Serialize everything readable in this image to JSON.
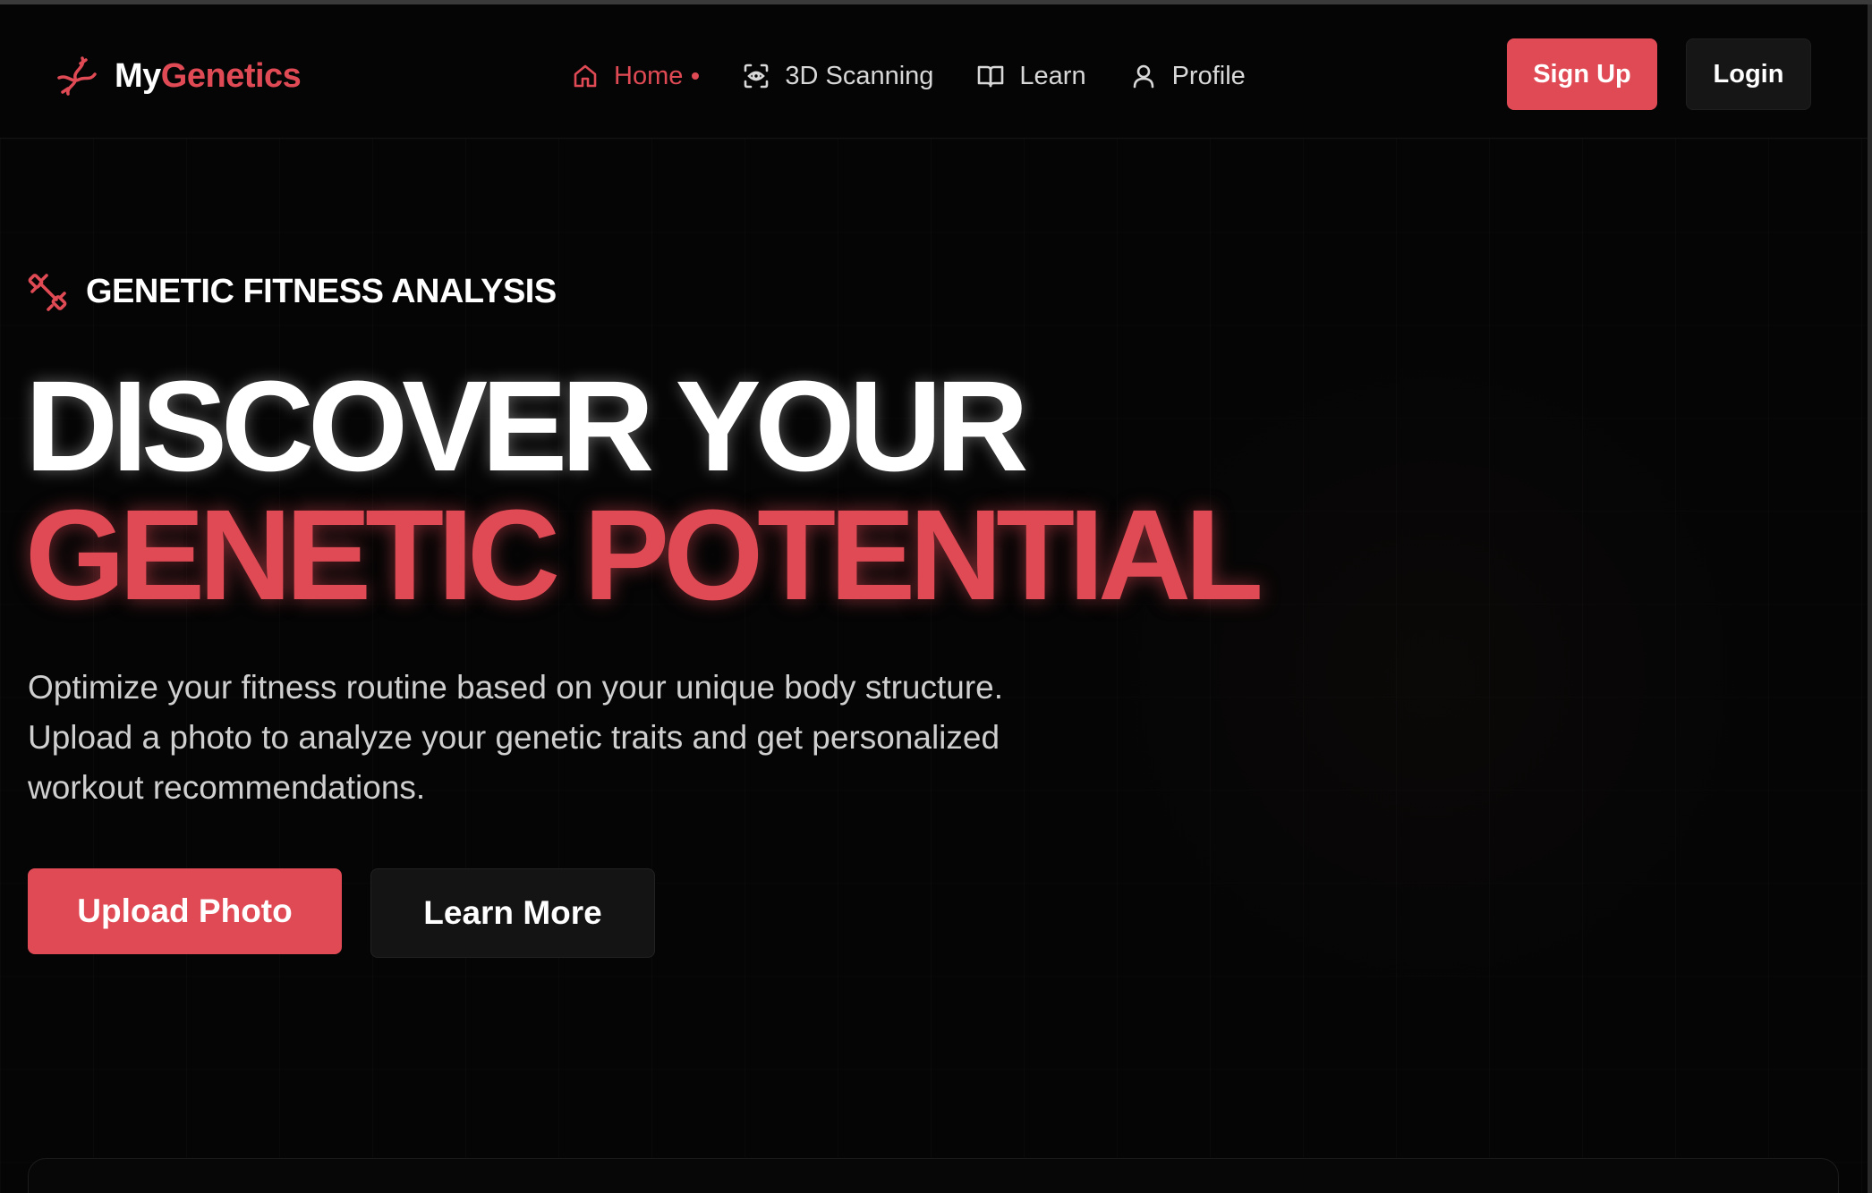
{
  "brand": {
    "name_part1": "My",
    "name_part2": "Genetics",
    "logo_icon": "dna-icon",
    "accent_color": "#e04a55"
  },
  "nav": {
    "links": [
      {
        "label": "Home",
        "icon": "home-icon",
        "active": true
      },
      {
        "label": "3D Scanning",
        "icon": "scan-icon",
        "active": false
      },
      {
        "label": "Learn",
        "icon": "book-icon",
        "active": false
      },
      {
        "label": "Profile",
        "icon": "user-icon",
        "active": false
      }
    ],
    "signup_label": "Sign Up",
    "login_label": "Login"
  },
  "hero": {
    "eyebrow_icon": "dumbbell-icon",
    "eyebrow": "GENETIC FITNESS ANALYSIS",
    "headline_line1": "DISCOVER YOUR",
    "headline_line2": "GENETIC POTENTIAL",
    "description": "Optimize your fitness routine based on your unique body structure. Upload a photo to analyze your genetic traits and get personalized workout recommendations.",
    "primary_cta": "Upload Photo",
    "secondary_cta": "Learn More"
  }
}
